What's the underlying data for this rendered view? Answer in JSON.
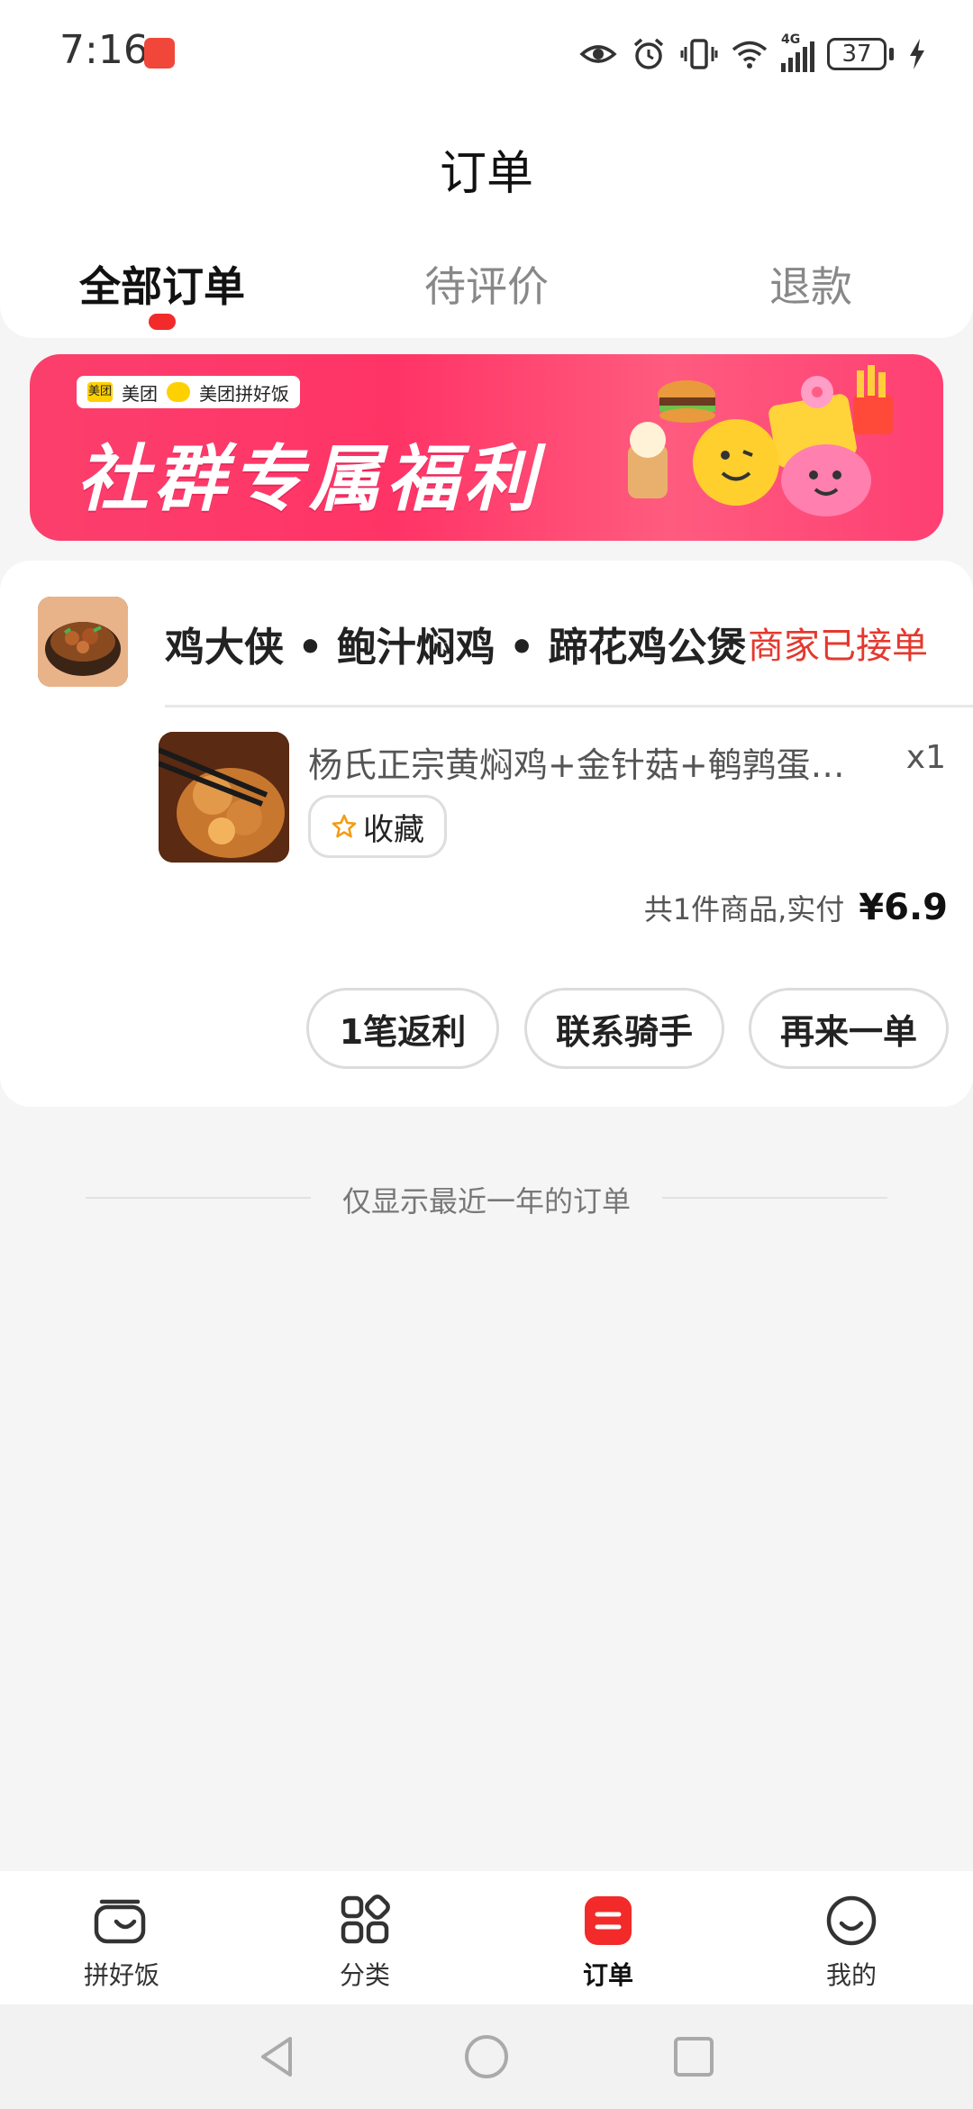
{
  "status_bar": {
    "time": "7:16",
    "network": "4G",
    "battery": "37",
    "icons": [
      "eye-icon",
      "alarm-icon",
      "vibrate-icon",
      "wifi-icon",
      "signal-icon",
      "battery-icon",
      "charging-icon"
    ]
  },
  "header": {
    "title": "订单",
    "tabs": [
      {
        "label": "全部订单",
        "active": true
      },
      {
        "label": "待评价",
        "active": false
      },
      {
        "label": "退款",
        "active": false
      }
    ]
  },
  "banner": {
    "brand_meituan": "美团",
    "brand_pinhaofan": "美团拼好饭",
    "brand_small": "美团",
    "headline": "社群专属福利"
  },
  "order": {
    "store_name": "鸡大侠 • 鲍汁焖鸡 • 蹄花鸡公煲",
    "status": "商家已接单",
    "item_name": "杨氏正宗黄焖鸡+金针菇+鹌鹑蛋…",
    "item_qty": "x1",
    "favorite_label": "收藏",
    "summary_text": "共1件商品,实付",
    "price": "¥6.9",
    "actions": [
      "1笔返利",
      "联系骑手",
      "再来一单"
    ]
  },
  "footer_note": "仅显示最近一年的订单",
  "bottom_nav": {
    "items": [
      {
        "label": "拼好饭",
        "icon": "pinhaofan-icon"
      },
      {
        "label": "分类",
        "icon": "category-icon"
      },
      {
        "label": "订单",
        "icon": "order-icon",
        "active": true
      },
      {
        "label": "我的",
        "icon": "profile-icon"
      }
    ]
  },
  "colors": {
    "accent_red": "#f22a2a",
    "status_red": "#e5382e",
    "banner_pink": "#ff3466"
  }
}
